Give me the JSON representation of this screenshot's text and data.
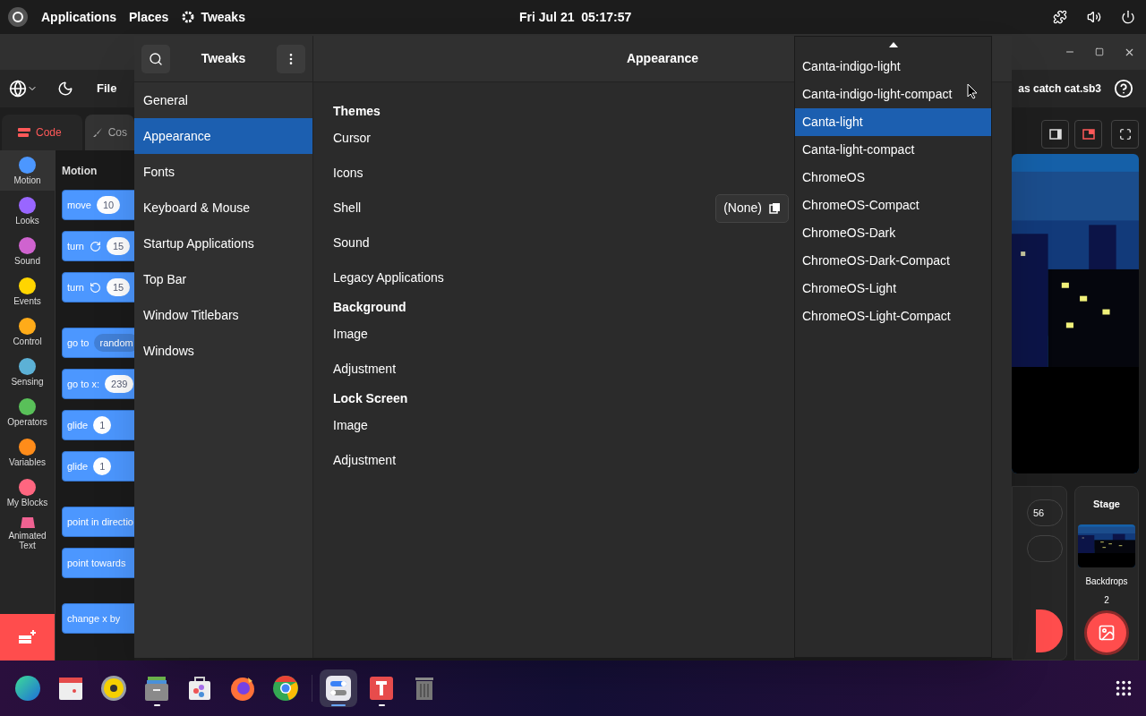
{
  "top_bar": {
    "menus": [
      "Applications",
      "Places"
    ],
    "app_name": "Tweaks",
    "clock": "Fri Jul 21  05:17:57"
  },
  "scratch": {
    "menu": [
      "File"
    ],
    "project_title": "as catch cat.sb3",
    "tabs": [
      {
        "label": "Code",
        "selected": true
      },
      {
        "label": "Cos",
        "selected": false
      }
    ],
    "categories": [
      {
        "label": "Motion",
        "color": "#4c97ff",
        "selected": true
      },
      {
        "label": "Looks",
        "color": "#9966ff",
        "selected": false
      },
      {
        "label": "Sound",
        "color": "#cf63cf",
        "selected": false
      },
      {
        "label": "Events",
        "color": "#ffd500",
        "selected": false
      },
      {
        "label": "Control",
        "color": "#ffab19",
        "selected": false
      },
      {
        "label": "Sensing",
        "color": "#5cb1d6",
        "selected": false
      },
      {
        "label": "Operators",
        "color": "#59c059",
        "selected": false
      },
      {
        "label": "Variables",
        "color": "#ff8c1a",
        "selected": false
      },
      {
        "label": "My Blocks",
        "color": "#ff6680",
        "selected": false
      },
      {
        "label": "Animated Text",
        "kind": "extension",
        "selected": false
      }
    ],
    "palette_title": "Motion",
    "block_groups": [
      {
        "blocks": [
          {
            "parts": [
              {
                "kind": "text",
                "text": "move"
              },
              {
                "kind": "input",
                "text": "10"
              }
            ]
          },
          {
            "parts": [
              {
                "kind": "text",
                "text": "turn"
              },
              {
                "kind": "rotate_right"
              },
              {
                "kind": "input",
                "text": "15"
              }
            ]
          },
          {
            "parts": [
              {
                "kind": "text",
                "text": "turn"
              },
              {
                "kind": "rotate_left"
              },
              {
                "kind": "input",
                "text": "15"
              }
            ]
          }
        ]
      },
      {
        "blocks": [
          {
            "parts": [
              {
                "kind": "text",
                "text": "go to"
              },
              {
                "kind": "dropdown",
                "text": "random"
              }
            ]
          },
          {
            "parts": [
              {
                "kind": "text",
                "text": "go to x:"
              },
              {
                "kind": "input",
                "text": "239"
              }
            ]
          },
          {
            "parts": [
              {
                "kind": "text",
                "text": "glide"
              },
              {
                "kind": "input",
                "text": "1"
              }
            ]
          },
          {
            "parts": [
              {
                "kind": "text",
                "text": "glide"
              },
              {
                "kind": "input",
                "text": "1"
              }
            ]
          }
        ]
      },
      {
        "blocks": [
          {
            "parts": [
              {
                "kind": "text",
                "text": "point in directio"
              }
            ]
          },
          {
            "parts": [
              {
                "kind": "text",
                "text": "point towards"
              }
            ]
          }
        ]
      },
      {
        "blocks": [
          {
            "parts": [
              {
                "kind": "text",
                "text": "change x by"
              }
            ]
          }
        ]
      }
    ],
    "sprite_fields": [
      "56"
    ],
    "stage": {
      "title": "Stage",
      "backdrops_label": "Backdrops",
      "backdrops_count": "2"
    }
  },
  "tweaks": {
    "title": "Tweaks",
    "page_title": "Appearance",
    "sidebar": [
      {
        "label": "General",
        "selected": false
      },
      {
        "label": "Appearance",
        "selected": true
      },
      {
        "label": "Fonts",
        "selected": false
      },
      {
        "label": "Keyboard & Mouse",
        "selected": false
      },
      {
        "label": "Startup Applications",
        "selected": false
      },
      {
        "label": "Top Bar",
        "selected": false
      },
      {
        "label": "Window Titlebars",
        "selected": false
      },
      {
        "label": "Windows",
        "selected": false
      }
    ],
    "sections": [
      {
        "title": "Themes",
        "rows": [
          {
            "label": "Cursor"
          },
          {
            "label": "Icons"
          },
          {
            "label": "Shell",
            "value": "(None)"
          },
          {
            "label": "Sound"
          },
          {
            "label": "Legacy Applications"
          }
        ]
      },
      {
        "title": "Background",
        "rows": [
          {
            "label": "Image"
          },
          {
            "label": "Adjustment"
          }
        ]
      },
      {
        "title": "Lock Screen",
        "rows": [
          {
            "label": "Image"
          },
          {
            "label": "Adjustment"
          }
        ]
      }
    ]
  },
  "dropdown": {
    "items": [
      {
        "label": "Canta-indigo-light",
        "selected": false
      },
      {
        "label": "Canta-indigo-light-compact",
        "selected": false
      },
      {
        "label": "Canta-light",
        "selected": true
      },
      {
        "label": "Canta-light-compact",
        "selected": false
      },
      {
        "label": "ChromeOS",
        "selected": false
      },
      {
        "label": "ChromeOS-Compact",
        "selected": false
      },
      {
        "label": "ChromeOS-Dark",
        "selected": false
      },
      {
        "label": "ChromeOS-Dark-Compact",
        "selected": false
      },
      {
        "label": "ChromeOS-Light",
        "selected": false
      },
      {
        "label": "ChromeOS-Light-Compact",
        "selected": false
      }
    ]
  },
  "dock": {
    "items": [
      {
        "kind": "browser",
        "running": false,
        "selected": false
      },
      {
        "kind": "calendar",
        "running": false,
        "selected": false
      },
      {
        "kind": "speaker",
        "running": false,
        "selected": false
      },
      {
        "kind": "files",
        "running": true,
        "selected": false
      },
      {
        "kind": "store",
        "running": false,
        "selected": false
      },
      {
        "kind": "firefox",
        "running": false,
        "selected": false
      },
      {
        "kind": "chrome",
        "running": false,
        "selected": false
      },
      {
        "kind": "tweaks",
        "running": true,
        "selected": true
      },
      {
        "kind": "scratch",
        "running": true,
        "selected": false
      },
      {
        "kind": "trash",
        "running": false,
        "selected": false
      }
    ]
  }
}
